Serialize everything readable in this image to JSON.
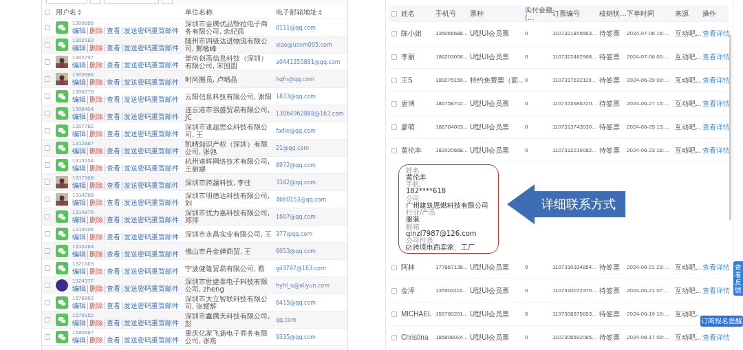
{
  "user_table": {
    "all_checked": false,
    "columns": [
      {
        "label": "用户名",
        "sortable": true
      },
      {
        "label": "单位名称",
        "sortable": false
      },
      {
        "label": "电子邮箱地址",
        "sortable": true
      }
    ],
    "rows": [
      {
        "checked": false,
        "avatar": {
          "kind": "wechat"
        },
        "phone": "1309886",
        "actions": [
          {
            "label": "编辑",
            "kind": "link"
          },
          {
            "label": "删除",
            "kind": "danger"
          },
          {
            "label": "查看",
            "kind": "link"
          },
          {
            "label": "发送密码重置邮件",
            "kind": "link"
          }
        ],
        "company": "深圳市金腾优品暨拉电子商务有限公司, 余紀孺",
        "email": "0111@qq.com"
      },
      {
        "checked": false,
        "avatar": {
          "kind": "wechat"
        },
        "phone": "1302183",
        "actions": [
          {
            "label": "编辑",
            "kind": "link"
          },
          {
            "label": "删除",
            "kind": "danger"
          },
          {
            "label": "查看",
            "kind": "link"
          },
          {
            "label": "发送密码重置邮件",
            "kind": "link"
          }
        ],
        "company": "随州市四级达进物流有限公司, 鄭敏峰",
        "email": "xiao@usnm005.com"
      },
      {
        "checked": false,
        "phone": "1302797",
        "actions": [
          {
            "label": "编辑",
            "kind": "link"
          },
          {
            "label": "删除",
            "kind": "danger"
          },
          {
            "label": "查看",
            "kind": "link"
          },
          {
            "label": "发送密码重置邮件",
            "kind": "link"
          }
        ],
        "company": "景尚创高信息科技（深圳）有限公司, 宋国圆",
        "email": "a0441355881@qq.com"
      },
      {
        "checked": false,
        "phone": "1303986",
        "actions": [
          {
            "label": "编辑",
            "kind": "link"
          },
          {
            "label": "删除",
            "kind": "danger"
          },
          {
            "label": "查看",
            "kind": "link"
          },
          {
            "label": "发送密码重置邮件",
            "kind": "link"
          }
        ],
        "company": "时尚圈员, 卢晴晶",
        "email": "hqfn@qq.com"
      },
      {
        "checked": false,
        "avatar": {
          "kind": "wechat"
        },
        "phone": "1306279",
        "actions": [
          {
            "label": "编辑",
            "kind": "link"
          },
          {
            "label": "删除",
            "kind": "danger"
          },
          {
            "label": "查看",
            "kind": "link"
          },
          {
            "label": "发送密码重置邮件",
            "kind": "link"
          }
        ],
        "company": "云阳信息科技有限公司, 谢阳",
        "email": "1833@qq.com"
      },
      {
        "checked": false,
        "avatar": {
          "kind": "wechat"
        },
        "phone": "1306404",
        "actions": [
          {
            "label": "编辑",
            "kind": "link"
          },
          {
            "label": "删除",
            "kind": "danger"
          },
          {
            "label": "查看",
            "kind": "link"
          },
          {
            "label": "发送密码重置邮件",
            "kind": "link"
          }
        ],
        "company": "连云港市强盛贸易有限公司, JC",
        "email": "13064962888@163.com"
      },
      {
        "checked": false,
        "avatar": {
          "kind": "wechat"
        },
        "phone": "1307782",
        "actions": [
          {
            "label": "编辑",
            "kind": "link"
          },
          {
            "label": "删除",
            "kind": "danger"
          },
          {
            "label": "查看",
            "kind": "link"
          },
          {
            "label": "发送密码重置邮件",
            "kind": "link"
          }
        ],
        "company": "深圳市速超思众科技有限公司, 王",
        "email": "fadie@qq.com"
      },
      {
        "checked": false,
        "avatar": {
          "kind": "wechat"
        },
        "phone": "1312887",
        "actions": [
          {
            "label": "编辑",
            "kind": "link"
          },
          {
            "label": "删除",
            "kind": "danger"
          },
          {
            "label": "查看",
            "kind": "link"
          },
          {
            "label": "发送密码重置邮件",
            "kind": "link"
          }
        ],
        "company": "凯晴知识产权（深圳）有限公司, 张弛",
        "email": "21@qq.com"
      },
      {
        "checked": false,
        "avatar": {
          "kind": "wechat"
        },
        "phone": "1313154",
        "actions": [
          {
            "label": "编辑",
            "kind": "link"
          },
          {
            "label": "删除",
            "kind": "danger"
          },
          {
            "label": "查看",
            "kind": "link"
          },
          {
            "label": "发送密码重置邮件",
            "kind": "link"
          }
        ],
        "company": "杭州速晖网络技术有限公司, 王丽娜",
        "email": "8972@qq.com"
      },
      {
        "checked": false,
        "phone": "1317368",
        "actions": [
          {
            "label": "编辑",
            "kind": "link"
          },
          {
            "label": "删除",
            "kind": "danger"
          },
          {
            "label": "查看",
            "kind": "link"
          },
          {
            "label": "发送密码重置邮件",
            "kind": "link"
          }
        ],
        "company": "深圳市跨越科技, 李佳",
        "email": "3342@qq.com"
      },
      {
        "checked": false,
        "phone": "1314268",
        "actions": [
          {
            "label": "编辑",
            "kind": "link"
          },
          {
            "label": "删除",
            "kind": "danger"
          },
          {
            "label": "查看",
            "kind": "link"
          },
          {
            "label": "发送密码重置邮件",
            "kind": "link"
          }
        ],
        "company": "深圳市明德达科技有限公司, 刘",
        "email": "4660153@qq.com"
      },
      {
        "checked": false,
        "avatar": {
          "kind": "wechat"
        },
        "phone": "1314875",
        "actions": [
          {
            "label": "编辑",
            "kind": "link"
          },
          {
            "label": "删除",
            "kind": "danger"
          },
          {
            "label": "查看",
            "kind": "link"
          },
          {
            "label": "发送密码重置邮件",
            "kind": "link"
          }
        ],
        "company": "深圳市优力嘉科技有限公司, 邓萍",
        "email": "1607@qq.com"
      },
      {
        "checked": false,
        "avatar": {
          "kind": "wechat"
        },
        "phone": "1314996",
        "actions": [
          {
            "label": "编辑",
            "kind": "link"
          },
          {
            "label": "删除",
            "kind": "danger"
          },
          {
            "label": "查看",
            "kind": "link"
          },
          {
            "label": "发送密码重置邮件",
            "kind": "link"
          }
        ],
        "company": "深圳市永昌实业有限公司, 王",
        "email": "377@qq.com"
      },
      {
        "checked": false,
        "avatar": {
          "kind": "wechat"
        },
        "phone": "1315284",
        "actions": [
          {
            "label": "编辑",
            "kind": "link"
          },
          {
            "label": "删除",
            "kind": "danger"
          },
          {
            "label": "查看",
            "kind": "link"
          },
          {
            "label": "发送密码重置邮件",
            "kind": "link"
          }
        ],
        "company": "佛山市丹金婵商贸, 王",
        "email": "6053@qq.com"
      },
      {
        "checked": false,
        "avatar": {
          "kind": "wechat"
        },
        "phone": "1321663",
        "actions": [
          {
            "label": "编辑",
            "kind": "link"
          },
          {
            "label": "删除",
            "kind": "danger"
          },
          {
            "label": "查看",
            "kind": "link"
          },
          {
            "label": "发送密码重置邮件",
            "kind": "link"
          }
        ],
        "company": "宁波健隆贸易有限公司, 蔡",
        "email": "gil3797@163.com"
      },
      {
        "checked": false,
        "avatar": {
          "kind": "dot"
        },
        "phone": "1324377",
        "actions": [
          {
            "label": "编辑",
            "kind": "link"
          },
          {
            "label": "删除",
            "kind": "danger"
          },
          {
            "label": "查看",
            "kind": "link"
          },
          {
            "label": "发送密码重置邮件",
            "kind": "link"
          }
        ],
        "company": "深圳市世捷泰电子科技有限公司, zheng",
        "email": "hyhl_u@aliyun.com"
      },
      {
        "checked": false,
        "avatar": {
          "kind": "wechat"
        },
        "phone": "1576863",
        "actions": [
          {
            "label": "编辑",
            "kind": "link"
          },
          {
            "label": "删除",
            "kind": "danger"
          },
          {
            "label": "查看",
            "kind": "link"
          },
          {
            "label": "发送密码重置邮件",
            "kind": "link"
          }
        ],
        "company": "深圳市大立智联科技有限公司, 张耀辉",
        "email": "6415@qq.com"
      },
      {
        "checked": false,
        "avatar": {
          "kind": "wechat"
        },
        "phone": "1579152",
        "actions": [
          {
            "label": "编辑",
            "kind": "link"
          },
          {
            "label": "删除",
            "kind": "danger"
          },
          {
            "label": "查看",
            "kind": "link"
          },
          {
            "label": "发送密码重置邮件",
            "kind": "link"
          }
        ],
        "company": "深圳市鑫腾天科技有限公司, 彭",
        "email": "qq.com"
      },
      {
        "checked": false,
        "avatar": {
          "kind": "wechat"
        },
        "phone": "1580687",
        "actions": [
          {
            "label": "编辑",
            "kind": "link"
          },
          {
            "label": "删除",
            "kind": "danger"
          },
          {
            "label": "查看",
            "kind": "link"
          },
          {
            "label": "发送密码重置邮件",
            "kind": "link"
          }
        ],
        "company": "重庆亿家飞扬电子商务有限公司, 张燕",
        "email": "9335@qq.com"
      }
    ]
  },
  "order_table": {
    "all_checked": false,
    "columns": [
      "姓名",
      "手机号",
      "票种",
      "实付金额 (...",
      "订票编号",
      "核销状...",
      "下单时间",
      "来源",
      "操作"
    ],
    "rows_before": [
      {
        "checked": false,
        "name": "陈小姐",
        "phone": "135066688...",
        "ticket": "U型UI会员票",
        "amount": "0",
        "order_no": "1107321845563...",
        "status": "待签票",
        "time": "2024-07-06 16:...",
        "source": "互动吧...",
        "action": "查看详情"
      },
      {
        "checked": false,
        "name": "李丽",
        "phone": "186203008...",
        "ticket": "U型UI会员票",
        "amount": "0",
        "order_no": "1107322482968...",
        "status": "待签票",
        "time": "2024-07-06 00:...",
        "source": "互动吧...",
        "action": "查看详情"
      },
      {
        "checked": false,
        "name": "王S",
        "phone": "189275150...",
        "ticket": "特约免费票（面...",
        "amount": "0",
        "order_no": "1107317632119...",
        "status": "待签票",
        "time": "2024-06-29 09:...",
        "source": "互动吧...",
        "action": "查看详情"
      },
      {
        "checked": false,
        "name": "唐博",
        "phone": "186758702...",
        "ticket": "U型UI会员票",
        "amount": "0",
        "order_no": "1107315986720...",
        "status": "待签票",
        "time": "2024-06-27 15:...",
        "source": "互动吧...",
        "action": "查看详情"
      },
      {
        "checked": false,
        "name": "廖萌",
        "phone": "186784003...",
        "ticket": "U型UI会员票",
        "amount": "0",
        "order_no": "1107313743930...",
        "status": "待签票",
        "time": "2024-06-25 13:...",
        "source": "互动吧...",
        "action": "查看详情"
      },
      {
        "checked": false,
        "name": "黄伦丰",
        "phone": "182020668...",
        "ticket": "U型UI会员票",
        "amount": "0",
        "order_no": "1107312219082...",
        "status": "待签票",
        "time": "2024-06-23 16:...",
        "source": "互动吧...",
        "action": "查看详情"
      }
    ],
    "detail": {
      "fields": [
        {
          "label": "姓名",
          "value": "黄伦丰"
        },
        {
          "label": "手机",
          "value": "182****618"
        },
        {
          "label": "公司",
          "value": "广州建筑恩燃科技有限公司"
        },
        {
          "label": "行业/产品",
          "value": "服装"
        },
        {
          "label": "邮箱",
          "value": "qinzl7987@126.com"
        },
        {
          "label": "公司性质",
          "value": "跨境电商卖家、工厂",
          "checked": true
        }
      ],
      "callout": "详细联系方式"
    },
    "rows_after": [
      {
        "checked": false,
        "name": "阿林",
        "phone": "177867138...",
        "ticket": "U型UI会员票",
        "amount": "0",
        "order_no": "1107310334854...",
        "status": "待签票",
        "time": "2024-06-21 23:...",
        "source": "互动吧...",
        "action": "查看详情"
      },
      {
        "checked": false,
        "name": "金泽",
        "phone": "135903116...",
        "ticket": "U型UI会员票",
        "amount": "0",
        "order_no": "1107310072370...",
        "status": "待签票",
        "time": "2024-06-21 07:...",
        "source": "互动吧...",
        "action": "查看详情"
      },
      {
        "checked": false,
        "name": "MICHAEL",
        "phone": "155780201...",
        "ticket": "U型UI会员票",
        "amount": "0",
        "order_no": "1107308875653...",
        "status": "待签票",
        "time": "2024-06-19 10:...",
        "source": "互动吧..."
      },
      {
        "checked": false,
        "name": "Christina",
        "phone": "185808024...",
        "ticket": "U型UI会员票",
        "amount": "0",
        "order_no": "1107306592085...",
        "status": "待签票",
        "time": "2024-06-17 09:...",
        "source": "互动吧...",
        "action": "查看详情"
      }
    ]
  },
  "feedback_tab": "查看反馈",
  "subscribe_badge": "订阅报名提醒"
}
